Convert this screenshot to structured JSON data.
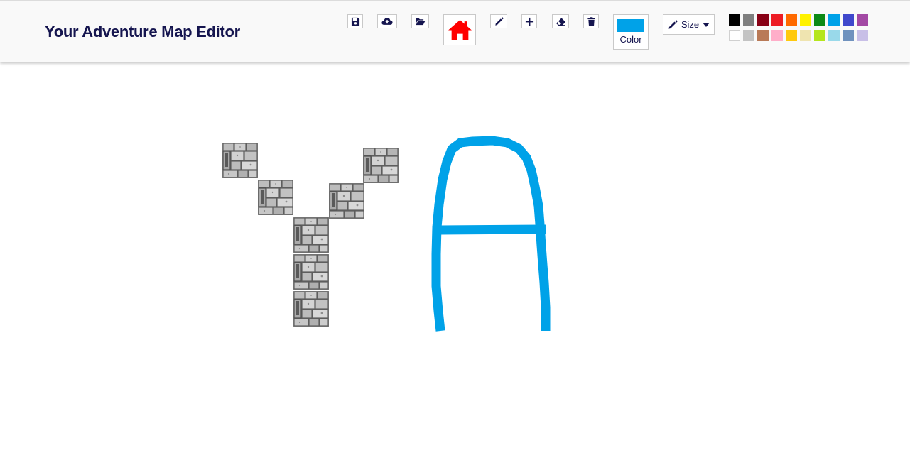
{
  "app": {
    "title": "Your Adventure Map Editor"
  },
  "toolbar": {
    "color_label": "Color",
    "size_label": "Size",
    "current_color": "#00a2e8",
    "home_icon_color": "#ff0000",
    "icon_color": "#15154f"
  },
  "palette": {
    "row1": [
      "#000000",
      "#7f7f7f",
      "#880015",
      "#ed1c24",
      "#ff6a00",
      "#fff200",
      "#0e8a16",
      "#00a2e8",
      "#3f48cc",
      "#a349a4"
    ],
    "row2": [
      "#ffffff",
      "#c3c3c3",
      "#b97a57",
      "#ffaec9",
      "#ffc90e",
      "#efe4b0",
      "#b5e61d",
      "#99d9ea",
      "#7092be",
      "#c8bfe7"
    ]
  },
  "canvas": {
    "stroke_color": "#00a2e8",
    "tile_type": "stone-wall"
  }
}
